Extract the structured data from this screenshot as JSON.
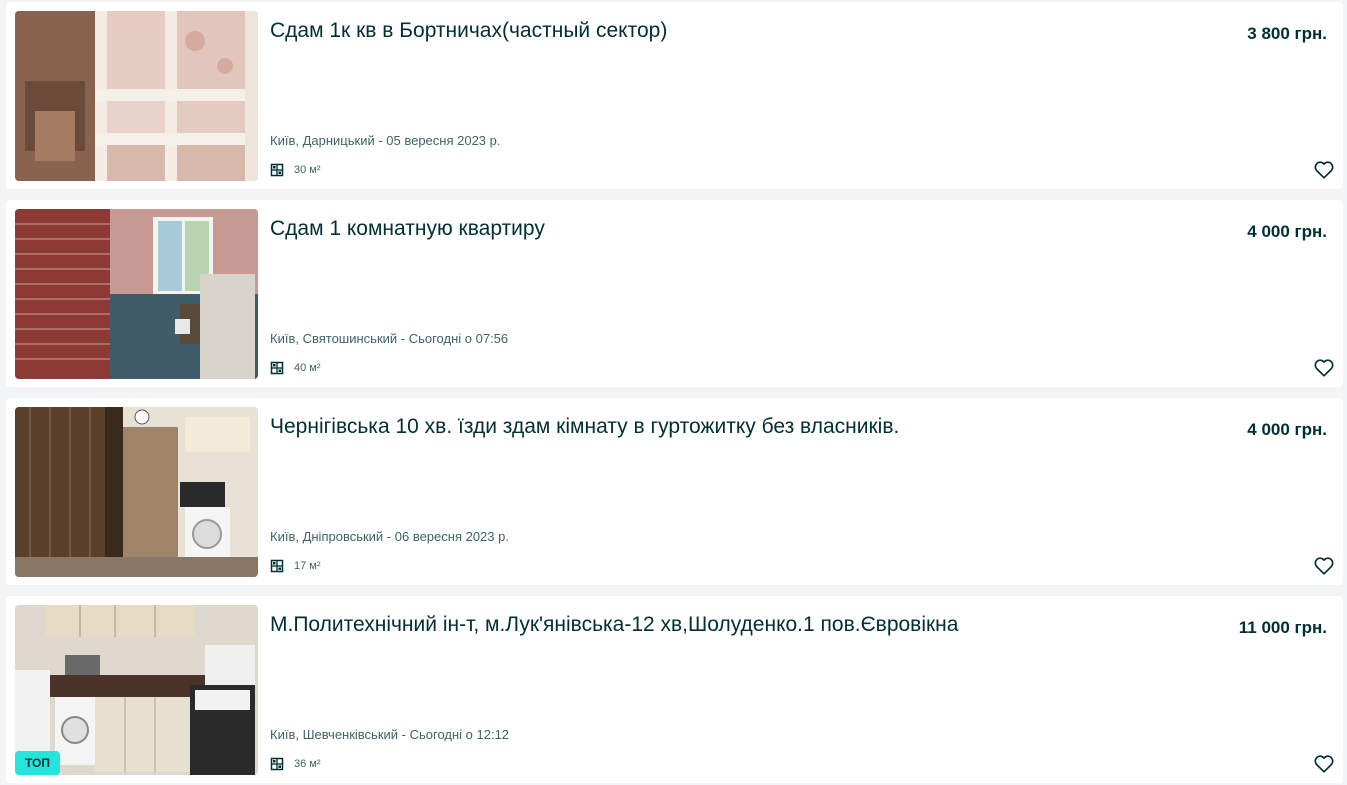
{
  "listings": [
    {
      "title": "Сдам 1к кв в Бортничах(частный сектор)",
      "price": "3 800 грн.",
      "location": "Київ, Дарницький - 05 вересня 2023 р.",
      "area": "30 м²",
      "favorite_icon": "heart-outline-icon",
      "area_icon": "floorplan-icon"
    },
    {
      "title": "Сдам 1 комнатную квартиру",
      "price": "4 000 грн.",
      "location": "Київ, Святошинський - Сьогодні о 07:56",
      "area": "40 м²",
      "favorite_icon": "heart-outline-icon",
      "area_icon": "floorplan-icon"
    },
    {
      "title": "Чернігівська 10 хв. їзди здам кімнату в гуртожитку без власників.",
      "price": "4 000 грн.",
      "location": "Київ, Дніпровський - 06 вересня 2023 р.",
      "area": "17 м²",
      "favorite_icon": "heart-outline-icon",
      "area_icon": "floorplan-icon"
    },
    {
      "title": "М.Политехнічний ін-т, м.Лук'янівська-12 хв,Шолуденко.1 пов.Євровікна",
      "price": "11 000 грн.",
      "location": "Київ, Шевченківський - Сьогодні о 12:12",
      "area": "36 м²",
      "badge": "ТОП",
      "favorite_icon": "heart-outline-icon",
      "area_icon": "floorplan-icon"
    }
  ],
  "colors": {
    "text_primary": "#002f34",
    "text_secondary": "#406367",
    "top_badge": "#23e5db",
    "background": "#f2f4f5"
  }
}
